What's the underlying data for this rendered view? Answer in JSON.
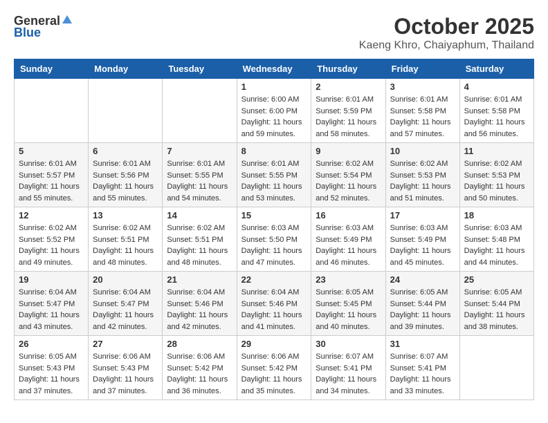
{
  "header": {
    "logo_general": "General",
    "logo_blue": "Blue",
    "month_title": "October 2025",
    "location": "Kaeng Khro, Chaiyaphum, Thailand"
  },
  "weekdays": [
    "Sunday",
    "Monday",
    "Tuesday",
    "Wednesday",
    "Thursday",
    "Friday",
    "Saturday"
  ],
  "weeks": [
    [
      {
        "day": "",
        "sunrise": "",
        "sunset": "",
        "daylight": ""
      },
      {
        "day": "",
        "sunrise": "",
        "sunset": "",
        "daylight": ""
      },
      {
        "day": "",
        "sunrise": "",
        "sunset": "",
        "daylight": ""
      },
      {
        "day": "1",
        "sunrise": "Sunrise: 6:00 AM",
        "sunset": "Sunset: 6:00 PM",
        "daylight": "Daylight: 11 hours and 59 minutes."
      },
      {
        "day": "2",
        "sunrise": "Sunrise: 6:01 AM",
        "sunset": "Sunset: 5:59 PM",
        "daylight": "Daylight: 11 hours and 58 minutes."
      },
      {
        "day": "3",
        "sunrise": "Sunrise: 6:01 AM",
        "sunset": "Sunset: 5:58 PM",
        "daylight": "Daylight: 11 hours and 57 minutes."
      },
      {
        "day": "4",
        "sunrise": "Sunrise: 6:01 AM",
        "sunset": "Sunset: 5:58 PM",
        "daylight": "Daylight: 11 hours and 56 minutes."
      }
    ],
    [
      {
        "day": "5",
        "sunrise": "Sunrise: 6:01 AM",
        "sunset": "Sunset: 5:57 PM",
        "daylight": "Daylight: 11 hours and 55 minutes."
      },
      {
        "day": "6",
        "sunrise": "Sunrise: 6:01 AM",
        "sunset": "Sunset: 5:56 PM",
        "daylight": "Daylight: 11 hours and 55 minutes."
      },
      {
        "day": "7",
        "sunrise": "Sunrise: 6:01 AM",
        "sunset": "Sunset: 5:55 PM",
        "daylight": "Daylight: 11 hours and 54 minutes."
      },
      {
        "day": "8",
        "sunrise": "Sunrise: 6:01 AM",
        "sunset": "Sunset: 5:55 PM",
        "daylight": "Daylight: 11 hours and 53 minutes."
      },
      {
        "day": "9",
        "sunrise": "Sunrise: 6:02 AM",
        "sunset": "Sunset: 5:54 PM",
        "daylight": "Daylight: 11 hours and 52 minutes."
      },
      {
        "day": "10",
        "sunrise": "Sunrise: 6:02 AM",
        "sunset": "Sunset: 5:53 PM",
        "daylight": "Daylight: 11 hours and 51 minutes."
      },
      {
        "day": "11",
        "sunrise": "Sunrise: 6:02 AM",
        "sunset": "Sunset: 5:53 PM",
        "daylight": "Daylight: 11 hours and 50 minutes."
      }
    ],
    [
      {
        "day": "12",
        "sunrise": "Sunrise: 6:02 AM",
        "sunset": "Sunset: 5:52 PM",
        "daylight": "Daylight: 11 hours and 49 minutes."
      },
      {
        "day": "13",
        "sunrise": "Sunrise: 6:02 AM",
        "sunset": "Sunset: 5:51 PM",
        "daylight": "Daylight: 11 hours and 48 minutes."
      },
      {
        "day": "14",
        "sunrise": "Sunrise: 6:02 AM",
        "sunset": "Sunset: 5:51 PM",
        "daylight": "Daylight: 11 hours and 48 minutes."
      },
      {
        "day": "15",
        "sunrise": "Sunrise: 6:03 AM",
        "sunset": "Sunset: 5:50 PM",
        "daylight": "Daylight: 11 hours and 47 minutes."
      },
      {
        "day": "16",
        "sunrise": "Sunrise: 6:03 AM",
        "sunset": "Sunset: 5:49 PM",
        "daylight": "Daylight: 11 hours and 46 minutes."
      },
      {
        "day": "17",
        "sunrise": "Sunrise: 6:03 AM",
        "sunset": "Sunset: 5:49 PM",
        "daylight": "Daylight: 11 hours and 45 minutes."
      },
      {
        "day": "18",
        "sunrise": "Sunrise: 6:03 AM",
        "sunset": "Sunset: 5:48 PM",
        "daylight": "Daylight: 11 hours and 44 minutes."
      }
    ],
    [
      {
        "day": "19",
        "sunrise": "Sunrise: 6:04 AM",
        "sunset": "Sunset: 5:47 PM",
        "daylight": "Daylight: 11 hours and 43 minutes."
      },
      {
        "day": "20",
        "sunrise": "Sunrise: 6:04 AM",
        "sunset": "Sunset: 5:47 PM",
        "daylight": "Daylight: 11 hours and 42 minutes."
      },
      {
        "day": "21",
        "sunrise": "Sunrise: 6:04 AM",
        "sunset": "Sunset: 5:46 PM",
        "daylight": "Daylight: 11 hours and 42 minutes."
      },
      {
        "day": "22",
        "sunrise": "Sunrise: 6:04 AM",
        "sunset": "Sunset: 5:46 PM",
        "daylight": "Daylight: 11 hours and 41 minutes."
      },
      {
        "day": "23",
        "sunrise": "Sunrise: 6:05 AM",
        "sunset": "Sunset: 5:45 PM",
        "daylight": "Daylight: 11 hours and 40 minutes."
      },
      {
        "day": "24",
        "sunrise": "Sunrise: 6:05 AM",
        "sunset": "Sunset: 5:44 PM",
        "daylight": "Daylight: 11 hours and 39 minutes."
      },
      {
        "day": "25",
        "sunrise": "Sunrise: 6:05 AM",
        "sunset": "Sunset: 5:44 PM",
        "daylight": "Daylight: 11 hours and 38 minutes."
      }
    ],
    [
      {
        "day": "26",
        "sunrise": "Sunrise: 6:05 AM",
        "sunset": "Sunset: 5:43 PM",
        "daylight": "Daylight: 11 hours and 37 minutes."
      },
      {
        "day": "27",
        "sunrise": "Sunrise: 6:06 AM",
        "sunset": "Sunset: 5:43 PM",
        "daylight": "Daylight: 11 hours and 37 minutes."
      },
      {
        "day": "28",
        "sunrise": "Sunrise: 6:06 AM",
        "sunset": "Sunset: 5:42 PM",
        "daylight": "Daylight: 11 hours and 36 minutes."
      },
      {
        "day": "29",
        "sunrise": "Sunrise: 6:06 AM",
        "sunset": "Sunset: 5:42 PM",
        "daylight": "Daylight: 11 hours and 35 minutes."
      },
      {
        "day": "30",
        "sunrise": "Sunrise: 6:07 AM",
        "sunset": "Sunset: 5:41 PM",
        "daylight": "Daylight: 11 hours and 34 minutes."
      },
      {
        "day": "31",
        "sunrise": "Sunrise: 6:07 AM",
        "sunset": "Sunset: 5:41 PM",
        "daylight": "Daylight: 11 hours and 33 minutes."
      },
      {
        "day": "",
        "sunrise": "",
        "sunset": "",
        "daylight": ""
      }
    ]
  ]
}
